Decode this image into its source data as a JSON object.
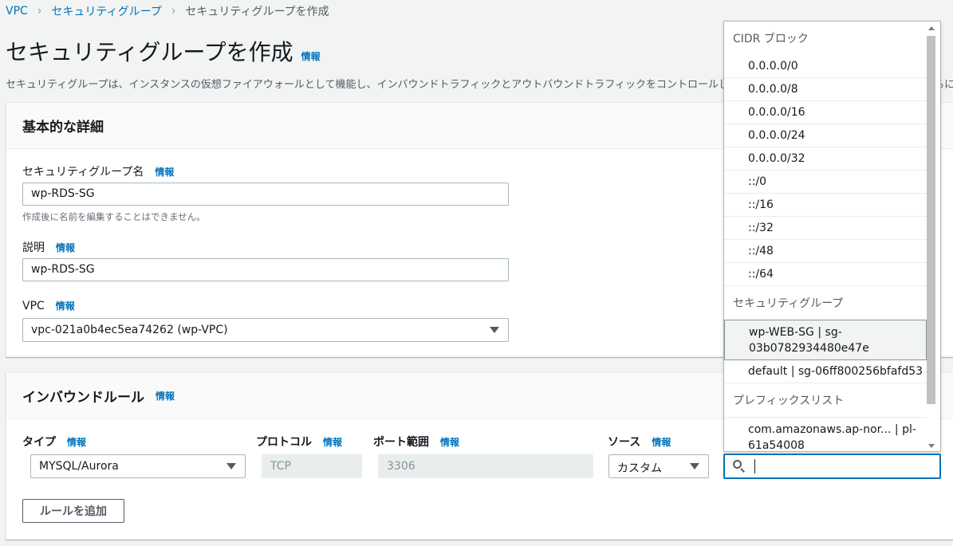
{
  "breadcrumb": {
    "items": [
      "VPC",
      "セキュリティグループ",
      "セキュリティグループを作成"
    ]
  },
  "info_label": "情報",
  "page": {
    "title": "セキュリティグループを作成",
    "description": "セキュリティグループは、インスタンスの仮想ファイアウォールとして機能し、インバウンドトラフィックとアウトバウンドトラフィックをコントロールします。新しいセキュリティグループを作成するには、以下のフィールドに入力してください。"
  },
  "basic": {
    "title": "基本的な詳細",
    "name_label": "セキュリティグループ名",
    "name_value": "wp-RDS-SG",
    "name_hint": "作成後に名前を編集することはできません。",
    "desc_label": "説明",
    "desc_value": "wp-RDS-SG",
    "vpc_label": "VPC",
    "vpc_value": "vpc-021a0b4ec5ea74262 (wp-VPC)"
  },
  "inbound": {
    "title": "インバウンドルール",
    "col_type": "タイプ",
    "col_protocol": "プロトコル",
    "col_port": "ポート範囲",
    "col_source": "ソース",
    "rule": {
      "type": "MYSQL/Aurora",
      "protocol": "TCP",
      "port": "3306",
      "source": "カスタム"
    },
    "add_rule": "ルールを追加"
  },
  "dropdown": {
    "group_cidr": "CIDR ブロック",
    "cidr_items": [
      "0.0.0.0/0",
      "0.0.0.0/8",
      "0.0.0.0/16",
      "0.0.0.0/24",
      "0.0.0.0/32",
      "::/0",
      "::/16",
      "::/32",
      "::/48",
      "::/64"
    ],
    "group_sg": "セキュリティグループ",
    "sg_item_1_line1": "wp-WEB-SG | sg-",
    "sg_item_1_line2": "03b0782934480e47e",
    "sg_item_2": "default | sg-06ff800256bfafd53",
    "group_prefix": "プレフィックスリスト",
    "prefix_item_line1": "com.amazonaws.ap-nor... | pl-",
    "prefix_item_line2": "61a54008"
  },
  "colors": {
    "link": "#0073bb",
    "background": "#f2f3f3",
    "focus": "#0073bb"
  }
}
